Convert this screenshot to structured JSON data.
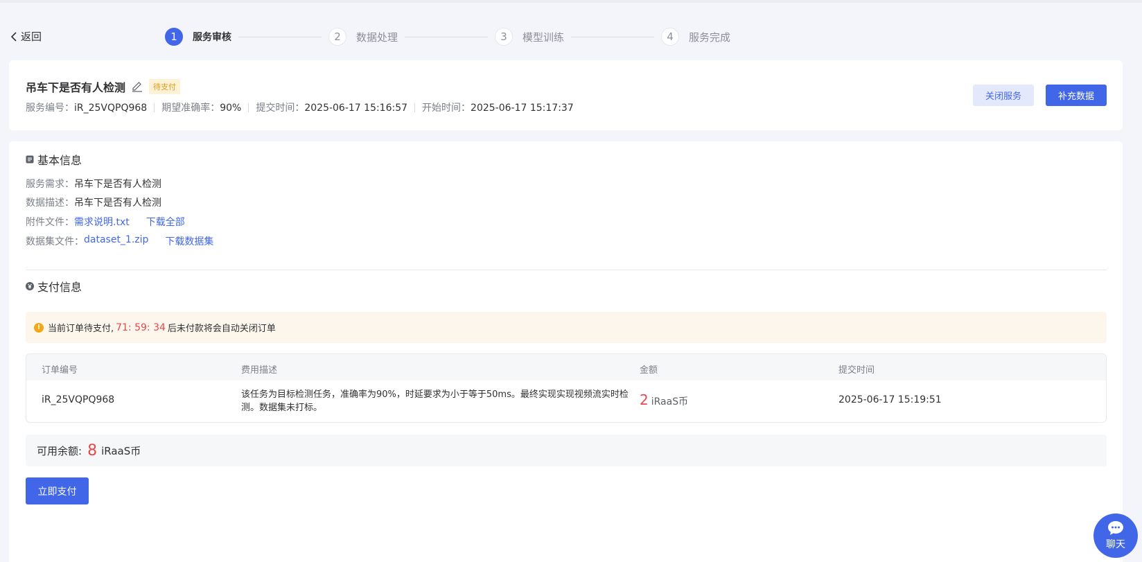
{
  "nav": {
    "back_label": "返回"
  },
  "steps": [
    {
      "num": "1",
      "label": "服务审核",
      "active": true
    },
    {
      "num": "2",
      "label": "数据处理",
      "active": false
    },
    {
      "num": "3",
      "label": "模型训练",
      "active": false
    },
    {
      "num": "4",
      "label": "服务完成",
      "active": false
    }
  ],
  "service": {
    "title": "吊车下是否有人检测",
    "status_badge": "待支付",
    "meta": [
      {
        "key": "服务编号：",
        "value": "iR_25VQPQ968"
      },
      {
        "key": "期望准确率：",
        "value": "90%"
      },
      {
        "key": "提交时间：",
        "value": "2025-06-17 15:16:57"
      },
      {
        "key": "开始时间：",
        "value": "2025-06-17 15:17:37"
      }
    ],
    "close_button": "关闭服务",
    "add_data_button": "补充数据"
  },
  "basic_info": {
    "title": "基本信息",
    "demand_label": "服务需求：",
    "demand_value": "吊车下是否有人检测",
    "desc_label": "数据描述：",
    "desc_value": "吊车下是否有人检测",
    "attachment_label": "附件文件：",
    "attachment_file": "需求说明.txt",
    "download_all": "下载全部",
    "dataset_label": "数据集文件：",
    "dataset_file": "dataset_1.zip",
    "download_dataset": "下载数据集"
  },
  "payment": {
    "title": "支付信息",
    "alert_prefix": "当前订单待支付,",
    "countdown": "71: 59: 34",
    "alert_suffix": "后未付款将会自动关闭订单",
    "table": {
      "headers": [
        "订单编号",
        "费用描述",
        "金额",
        "提交时间"
      ],
      "rows": [
        {
          "order_id": "iR_25VQPQ968",
          "description_line1": "该任务为目标检测任务，准确率为90%，时延要求为小于等于50ms。最终实现实现视频流实时检",
          "description_line2": "测。数据集未打标。",
          "amount": "2",
          "amount_unit": "iRaaS币",
          "submit_time": "2025-06-17 15:19:51"
        }
      ]
    },
    "balance_label": "可用余额:",
    "balance_value": "8",
    "balance_unit": "iRaaS币",
    "pay_button": "立即支付"
  },
  "chat": {
    "label": "聊天"
  },
  "colors": {
    "primary": "#4167e8",
    "danger": "#e5484d",
    "warning": "#f3a818"
  }
}
